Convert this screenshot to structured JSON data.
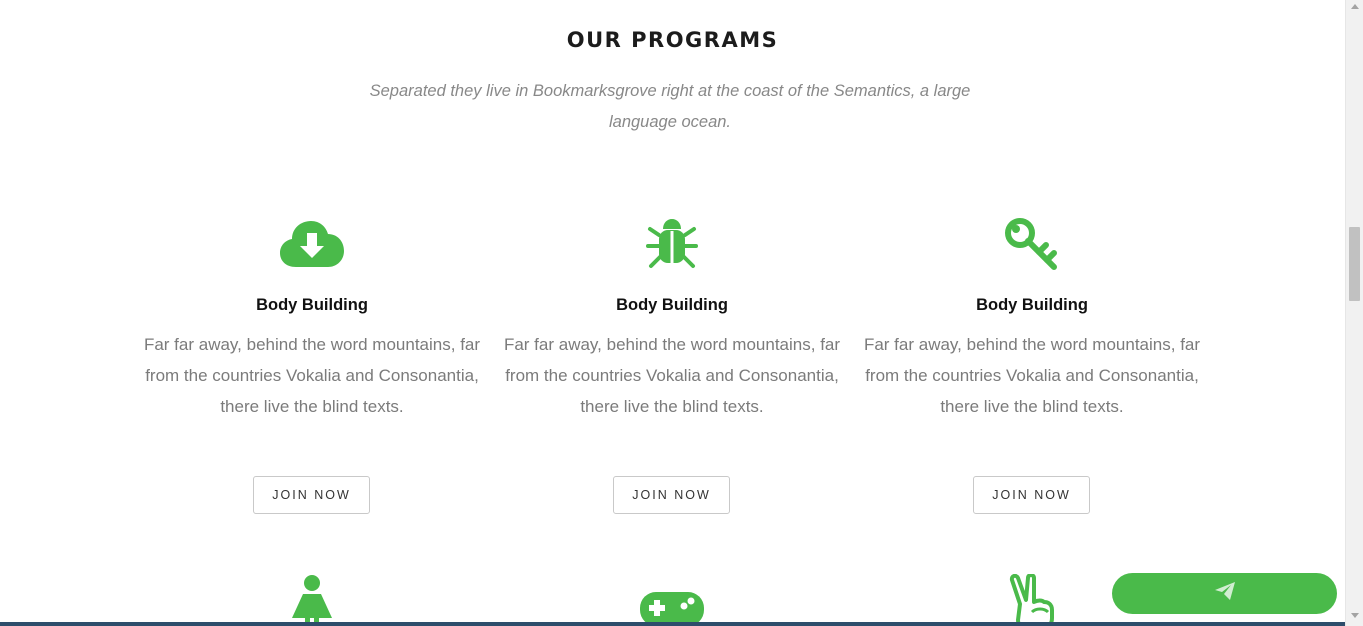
{
  "section": {
    "title": "OUR PROGRAMS",
    "subtitle": "Separated they live in Bookmarksgrove right at the coast of the Semantics, a large language ocean."
  },
  "programs": [
    {
      "icon": "cloud-download-icon",
      "title": "Body Building",
      "text": "Far far away, behind the word mountains, far from the countries Vokalia and Consonantia, there live the blind texts.",
      "button": "JOIN NOW"
    },
    {
      "icon": "bug-icon",
      "title": "Body Building",
      "text": "Far far away, behind the word mountains, far from the countries Vokalia and Consonantia, there live the blind texts.",
      "button": "JOIN NOW"
    },
    {
      "icon": "key-icon",
      "title": "Body Building",
      "text": "Far far away, behind the word mountains, far from the countries Vokalia and Consonantia, there live the blind texts.",
      "button": "JOIN NOW"
    }
  ],
  "next_row_icons": [
    "female-icon",
    "gamepad-icon",
    "peace-hand-icon"
  ],
  "send_button": {
    "icon": "paper-plane-icon"
  },
  "colors": {
    "accent": "#4aba4a",
    "title": "#1c1c1c",
    "body_text": "#7b7b7b",
    "subtitle": "#888888"
  }
}
